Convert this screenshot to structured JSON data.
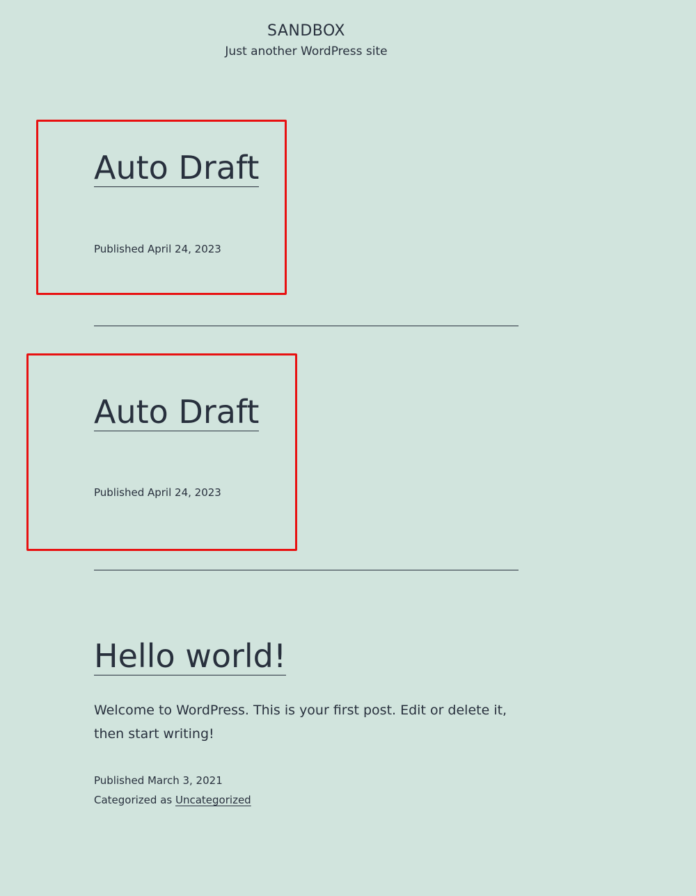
{
  "site": {
    "title": "SANDBOX",
    "tagline": "Just another WordPress site"
  },
  "posts": [
    {
      "title": "Auto Draft",
      "published": "Published April 24, 2023"
    },
    {
      "title": "Auto Draft",
      "published": "Published April 24, 2023"
    },
    {
      "title": "Hello world!",
      "excerpt": "Welcome to WordPress. This is your first post. Edit or delete it, then start writing!",
      "published": "Published March 3, 2021",
      "categorized_prefix": "Categorized as",
      "category": "Uncategorized"
    }
  ],
  "colors": {
    "background": "#d1e4dd",
    "text": "#28303d",
    "highlight": "#e81010"
  }
}
